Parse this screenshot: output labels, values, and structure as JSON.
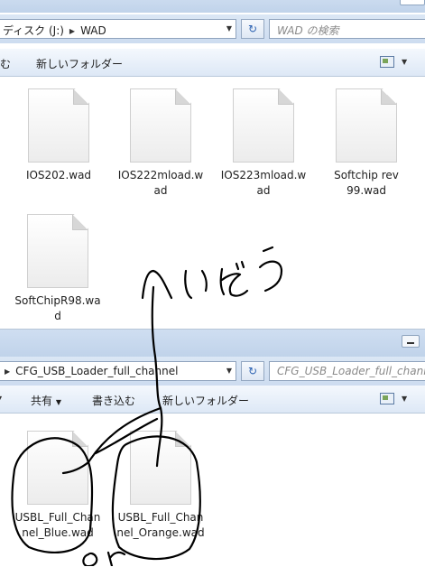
{
  "window_top": {
    "address": {
      "path": [
        "ディスク (J:)",
        "WAD"
      ]
    },
    "search": {
      "placeholder": "WAD の検索"
    },
    "toolbar": {
      "partial_item": "む",
      "new_folder": "新しいフォルダー"
    },
    "files": [
      {
        "name": "IOS202.wad"
      },
      {
        "name": "IOS222mload.wad"
      },
      {
        "name": "IOS223mload.wad"
      },
      {
        "name": "Softchip rev99.wad"
      },
      {
        "name": "SoftChipR98.wad"
      }
    ]
  },
  "window_bottom": {
    "address": {
      "path": [
        "CFG_USB_Loader_full_channel"
      ]
    },
    "search": {
      "placeholder": "CFG_USB_Loader_full_chann"
    },
    "toolbar": {
      "share": "共有",
      "burn": "書き込む",
      "new_folder": "新しいフォルダー"
    },
    "files": [
      {
        "name": "USBL_Full_Channel_Blue.wad"
      },
      {
        "name": "USBL_Full_Channel_Orange.wad"
      }
    ]
  },
  "annotations": {
    "handwritten_top": "へいどう",
    "handwritten_bottom": "or"
  },
  "colors": {
    "chrome": "#cddcf0",
    "ink": "#000000"
  }
}
